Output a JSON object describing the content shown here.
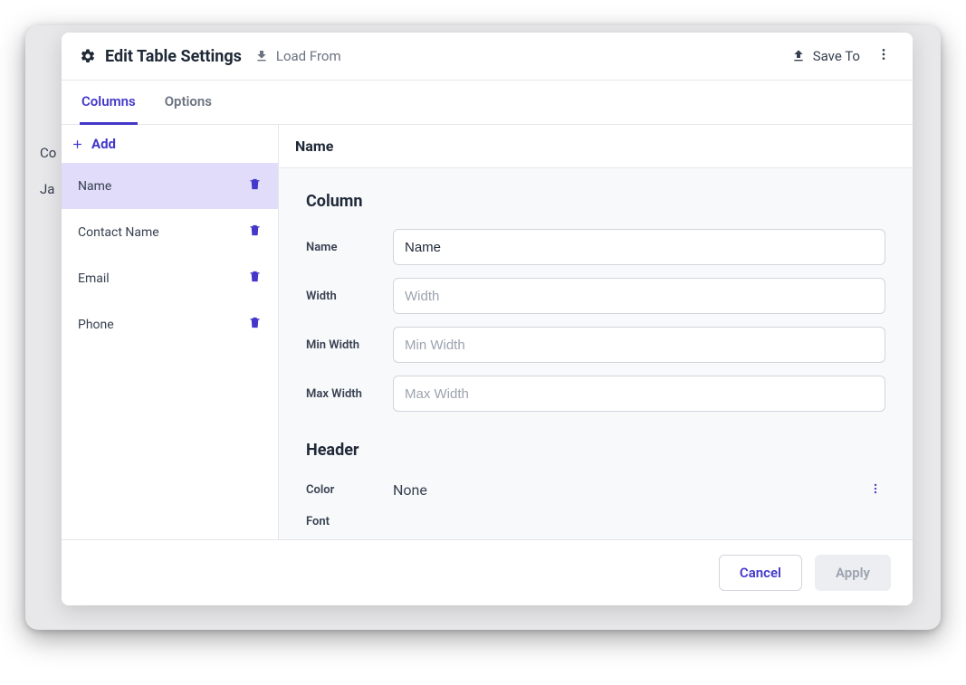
{
  "background": {
    "row1": "Co",
    "row2": "Ja"
  },
  "modal": {
    "title": "Edit Table Settings",
    "loadFrom": "Load From",
    "saveTo": "Save To"
  },
  "tabs": {
    "columns": "Columns",
    "options": "Options",
    "active": "columns"
  },
  "sidebar": {
    "addLabel": "Add",
    "items": [
      {
        "label": "Name",
        "selected": true
      },
      {
        "label": "Contact Name",
        "selected": false
      },
      {
        "label": "Email",
        "selected": false
      },
      {
        "label": "Phone",
        "selected": false
      }
    ]
  },
  "content": {
    "headerTitle": "Name",
    "sections": {
      "column": {
        "title": "Column",
        "fields": {
          "name": {
            "label": "Name",
            "value": "Name",
            "placeholder": "Name"
          },
          "width": {
            "label": "Width",
            "value": "",
            "placeholder": "Width"
          },
          "minWidth": {
            "label": "Min Width",
            "value": "",
            "placeholder": "Min Width"
          },
          "maxWidth": {
            "label": "Max Width",
            "value": "",
            "placeholder": "Max Width"
          }
        }
      },
      "header": {
        "title": "Header",
        "color": {
          "label": "Color",
          "value": "None"
        },
        "font": {
          "label": "Font"
        }
      }
    }
  },
  "footer": {
    "cancel": "Cancel",
    "apply": "Apply"
  },
  "colors": {
    "accent": "#4338ca",
    "muted": "#6b7280",
    "text": "#1f2937",
    "selectedBg": "#e0dcf9"
  }
}
